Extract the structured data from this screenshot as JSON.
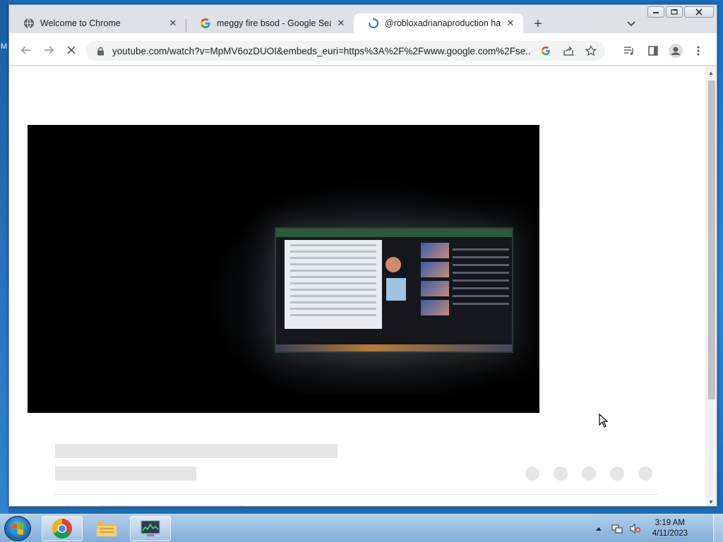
{
  "tabs": [
    {
      "title": "Welcome to Chrome",
      "favicon": "globe-icon",
      "active": false
    },
    {
      "title": "meggy fire bsod - Google Search",
      "favicon": "google-g-icon",
      "active": false
    },
    {
      "title": "@robloxadrianaproduction has b",
      "favicon": "loading-spinner-icon",
      "active": true
    }
  ],
  "toolbar": {
    "url": "youtube.com/watch?v=MpMV6ozDUOI&embeds_euri=https%3A%2F%2Fwww.google.com%2Fse..."
  },
  "desktop": {
    "glyph": "M"
  },
  "taskbar": {
    "time": "3:19 AM",
    "date": "4/11/2023"
  },
  "colors": {
    "accent": "#1a73e8",
    "tabstrip": "#dee1e6",
    "skeleton": "#e5e5e5"
  }
}
